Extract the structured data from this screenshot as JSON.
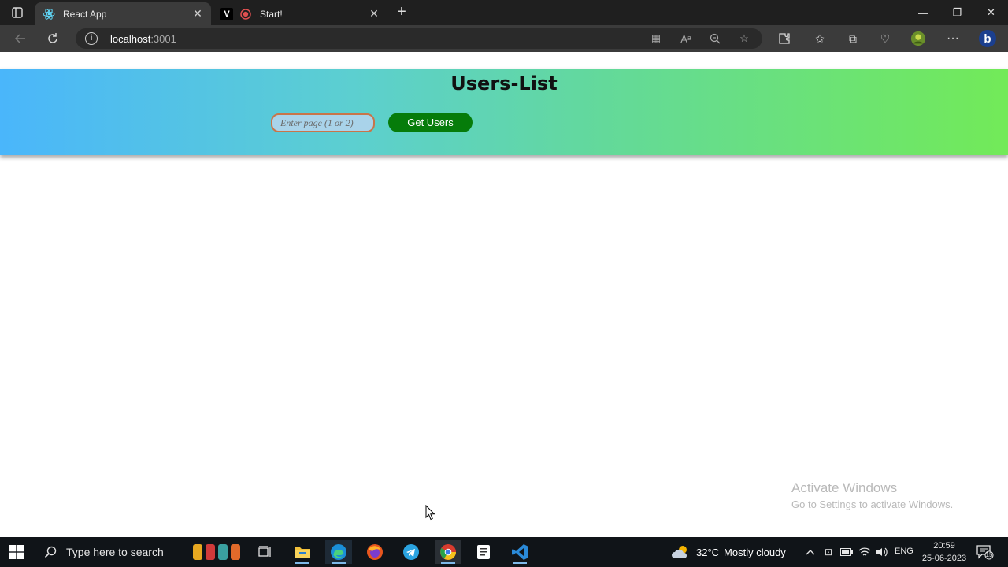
{
  "browser": {
    "tabs": [
      {
        "title": "React App",
        "active": true,
        "favicon": "react-icon"
      },
      {
        "title": "Start!",
        "active": false,
        "favicon": "record-icon"
      }
    ],
    "new_tab_label": "+",
    "address": {
      "host": "localhost",
      "port": ":3001"
    }
  },
  "app": {
    "title": "Users-List",
    "page_input_placeholder": "Enter page (1 or 2)",
    "get_users_label": "Get Users"
  },
  "watermark": {
    "line1": "Activate Windows",
    "line2": "Go to Settings to activate Windows."
  },
  "taskbar": {
    "search_placeholder": "Type here to search",
    "weather": {
      "temp": "32°C",
      "condition": "Mostly cloudy"
    },
    "language": "ENG",
    "time": "20:59",
    "date": "25-06-2023",
    "notification_count": "15"
  },
  "colors": {
    "banner_start": "#4ab6fb",
    "banner_end": "#72ea58",
    "button": "#067c0a",
    "input_bg": "#a9d3ea",
    "input_border": "#c8754a"
  }
}
